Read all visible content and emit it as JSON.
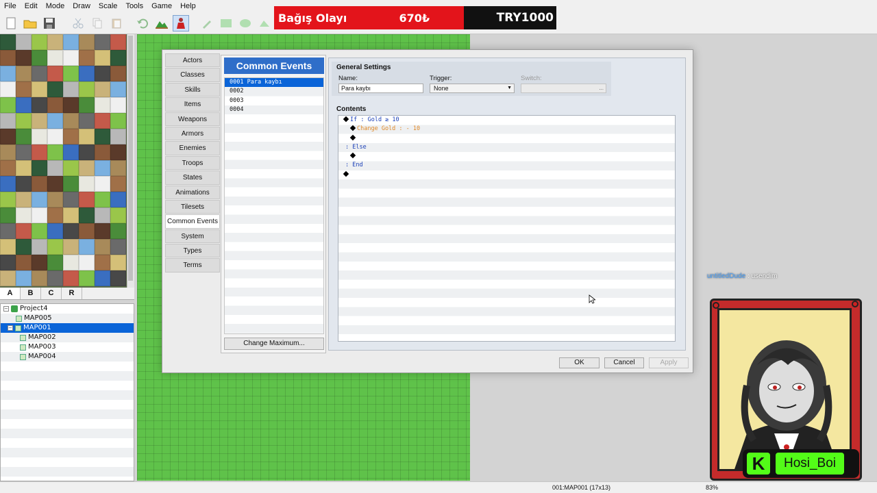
{
  "menubar": {
    "items": [
      "File",
      "Edit",
      "Mode",
      "Draw",
      "Scale",
      "Tools",
      "Game",
      "Help"
    ]
  },
  "toolbar": {
    "buttons": [
      "new-project",
      "open-project",
      "save-project",
      "cut",
      "copy",
      "paste",
      "undo",
      "map-mode",
      "event-mode",
      "pencil",
      "rectangle",
      "ellipse",
      "fill"
    ]
  },
  "donation": {
    "label": "Bağış Olayı",
    "amount": "670₺",
    "goal": "TRY1000"
  },
  "tileset_tabs": [
    "A",
    "B",
    "C",
    "R"
  ],
  "map_tree": [
    {
      "label": "Project4",
      "level": 0,
      "selected": false,
      "type": "project"
    },
    {
      "label": "MAP005",
      "level": 1,
      "selected": false,
      "type": "map"
    },
    {
      "label": "MAP001",
      "level": 1,
      "selected": true,
      "type": "map"
    },
    {
      "label": "MAP002",
      "level": 2,
      "selected": false,
      "type": "map"
    },
    {
      "label": "MAP003",
      "level": 2,
      "selected": false,
      "type": "map"
    },
    {
      "label": "MAP004",
      "level": 2,
      "selected": false,
      "type": "map"
    }
  ],
  "database": {
    "categories": [
      "Actors",
      "Classes",
      "Skills",
      "Items",
      "Weapons",
      "Armors",
      "Enemies",
      "Troops",
      "States",
      "Animations",
      "Tilesets",
      "Common Events",
      "System",
      "Types",
      "Terms"
    ],
    "active_category": "Common Events",
    "list_title": "Common Events",
    "entries": [
      {
        "label": "0001 Para kaybı",
        "selected": true
      },
      {
        "label": "0002",
        "selected": false
      },
      {
        "label": "0003",
        "selected": false
      },
      {
        "label": "0004",
        "selected": false
      }
    ],
    "change_max_label": "Change Maximum...",
    "general_settings": {
      "title": "General Settings",
      "name_label": "Name:",
      "name_value": "Para kaybı",
      "trigger_label": "Trigger:",
      "trigger_value": "None",
      "switch_label": "Switch:",
      "switch_button": "..."
    },
    "contents_title": "Contents",
    "commands": [
      {
        "text": "If : Gold ≥ 10",
        "indent": 0,
        "diamond": true,
        "color": "blue"
      },
      {
        "text": "Change Gold : - 10",
        "indent": 1,
        "diamond": true,
        "color": "orange"
      },
      {
        "text": "",
        "indent": 1,
        "diamond": true,
        "color": "black"
      },
      {
        "text": ": Else",
        "indent": 0,
        "diamond": false,
        "color": "blue"
      },
      {
        "text": "",
        "indent": 1,
        "diamond": true,
        "color": "black"
      },
      {
        "text": ": End",
        "indent": 0,
        "diamond": false,
        "color": "blue"
      },
      {
        "text": "",
        "indent": 0,
        "diamond": true,
        "color": "black"
      }
    ],
    "buttons": {
      "ok": "OK",
      "cancel": "Cancel",
      "apply": "Apply"
    }
  },
  "statusbar": {
    "map_info": "001:MAP001 (17x13)",
    "zoom": "83%"
  },
  "overlay": {
    "chat_user": "untitledDude",
    "chat_message": ": usendim",
    "streamer_name": "Hosi_Boi",
    "platform_letter": "K"
  }
}
